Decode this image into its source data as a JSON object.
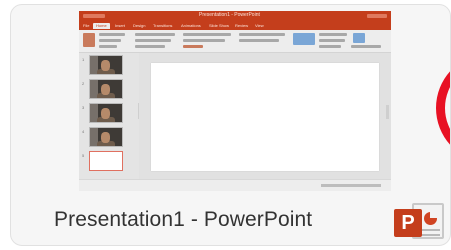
{
  "window_title": "Presentation1 - PowerPoint",
  "thumbnail": {
    "title_bar_text": "Presentation1 - PowerPoint",
    "ribbon_tabs": [
      "File",
      "Home",
      "Insert",
      "Design",
      "Transitions",
      "Animations",
      "Slide Show",
      "Review",
      "View"
    ],
    "active_tab": "Home"
  },
  "app_icon": {
    "name": "powerpoint-icon",
    "letter": "P"
  },
  "colors": {
    "powerpoint_brand": "#c43e1c",
    "accent_ring": "#e81123"
  }
}
